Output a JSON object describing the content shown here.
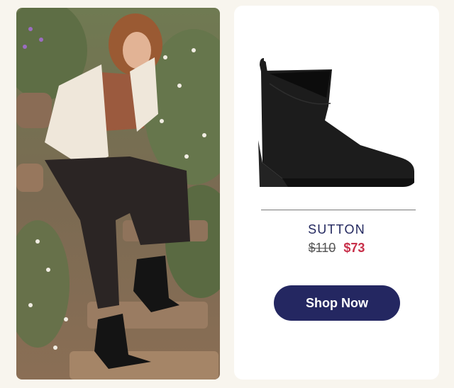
{
  "product": {
    "name": "SUTTON",
    "original_price": "$110",
    "sale_price": "$73",
    "cta_label": "Shop Now"
  },
  "colors": {
    "background": "#f8f5ee",
    "card": "#ffffff",
    "brand_navy": "#242761",
    "sale_red": "#c8304a"
  },
  "icons": {
    "lifestyle_photo": "woman-in-black-wedge-booties-photo",
    "product_photo": "black-wedge-bootie-photo"
  }
}
